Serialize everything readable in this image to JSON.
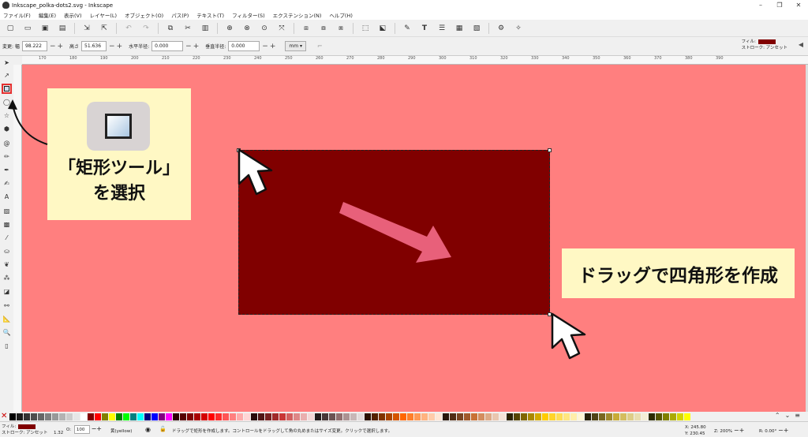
{
  "window": {
    "title": "Inkscape_polka-dots2.svg - Inkscape",
    "controls": [
      "–",
      "❐",
      "✕"
    ]
  },
  "menu": [
    "ファイル(F)",
    "編集(E)",
    "表示(V)",
    "レイヤー(L)",
    "オブジェクト(O)",
    "パス(P)",
    "テキスト(T)",
    "フィルター(S)",
    "エクステンション(N)",
    "ヘルプ(H)"
  ],
  "toolcontrols": {
    "change_w_label": "変更: 幅",
    "w_value": "98.222",
    "h_label": "高さ",
    "h_value": "51.636",
    "rx_label": "水平半径:",
    "rx_value": "0.000",
    "ry_label": "垂直半径:",
    "ry_value": "0.000",
    "unit": "mm ▾"
  },
  "style_indicator": {
    "fill_label": "フィル:",
    "stroke_label": "ストローク: アンセット",
    "fill_color": "#800000"
  },
  "ruler_ticks": [
    "170",
    "180",
    "190",
    "200",
    "210",
    "220",
    "230",
    "240",
    "250",
    "260",
    "270",
    "280",
    "290",
    "300",
    "310",
    "320",
    "330",
    "340",
    "350",
    "360",
    "370",
    "380",
    "390"
  ],
  "annotations": {
    "select_tool_line1": "「矩形ツール」",
    "select_tool_line2": "を選択",
    "drag_instruction": "ドラッグで四角形を作成"
  },
  "colors": {
    "canvas": "#ff7f7f",
    "rect_fill": "#800000",
    "callout_bg": "#fff8c4",
    "arrow": "#e8607a",
    "highlight": "#e53030"
  },
  "palette": [
    "#000000",
    "#1a1a1a",
    "#333333",
    "#4d4d4d",
    "#666666",
    "#808080",
    "#999999",
    "#b3b3b3",
    "#cccccc",
    "#e6e6e6",
    "#ffffff",
    "#800000",
    "#ff0000",
    "#808000",
    "#ffff00",
    "#008000",
    "#00ff00",
    "#008080",
    "#00ffff",
    "#000080",
    "#0000ff",
    "#800080",
    "#ff00ff",
    "#2b0000",
    "#550000",
    "#800000",
    "#aa0000",
    "#d40000",
    "#ff0000",
    "#ff2a2a",
    "#ff5555",
    "#ff8080",
    "#ffaaaa",
    "#ffd5d5",
    "#280b0b",
    "#501616",
    "#782121",
    "#a02c2c",
    "#c83737",
    "#d35f5f",
    "#de8787",
    "#e9afaf",
    "#f4d7d7",
    "#241c1c",
    "#483737",
    "#6c5353",
    "#916f6f",
    "#ac9393",
    "#c8b7b7",
    "#e3dbdb",
    "#2b1100",
    "#552200",
    "#803300",
    "#aa4400",
    "#d45500",
    "#ff6600",
    "#ff7f2a",
    "#ff9955",
    "#ffb380",
    "#ffccaa",
    "#ffe6d5",
    "#28170b",
    "#502d16",
    "#784421",
    "#a05a2c",
    "#c87137",
    "#d38d5f",
    "#deaa87",
    "#e9c6af",
    "#f4e3d7",
    "#2b2200",
    "#554400",
    "#806600",
    "#aa8800",
    "#d4aa00",
    "#ffcc00",
    "#ffd42a",
    "#ffdd55",
    "#ffe680",
    "#ffeeaa",
    "#fff6d5",
    "#28220b",
    "#504416",
    "#786721",
    "#a0892c",
    "#c8ab37",
    "#d4bd5f",
    "#decd87",
    "#e9ddaf",
    "#f4eed7",
    "#2b2b00",
    "#555500",
    "#808000",
    "#aaaa00",
    "#d4d400",
    "#ffff00"
  ],
  "status": {
    "fill_label": "フィル:",
    "stroke_label": "ストローク:",
    "stroke_value": "アンセット",
    "stroke_width": "1.32",
    "opacity_label": "O:",
    "opacity_value": "100",
    "layer": "黄(yellow)",
    "message": "ドラッグで矩形を作成します。コントロールをドラッグして角の丸めまたはサイズ変更。クリックで選択します。",
    "x_label": "X:",
    "x_value": "245.80",
    "y_label": "Y:",
    "y_value": "230.45",
    "zoom_label": "Z:",
    "zoom_value": "200%",
    "rotation_label": "R:",
    "rotation_value": "0.00°"
  }
}
